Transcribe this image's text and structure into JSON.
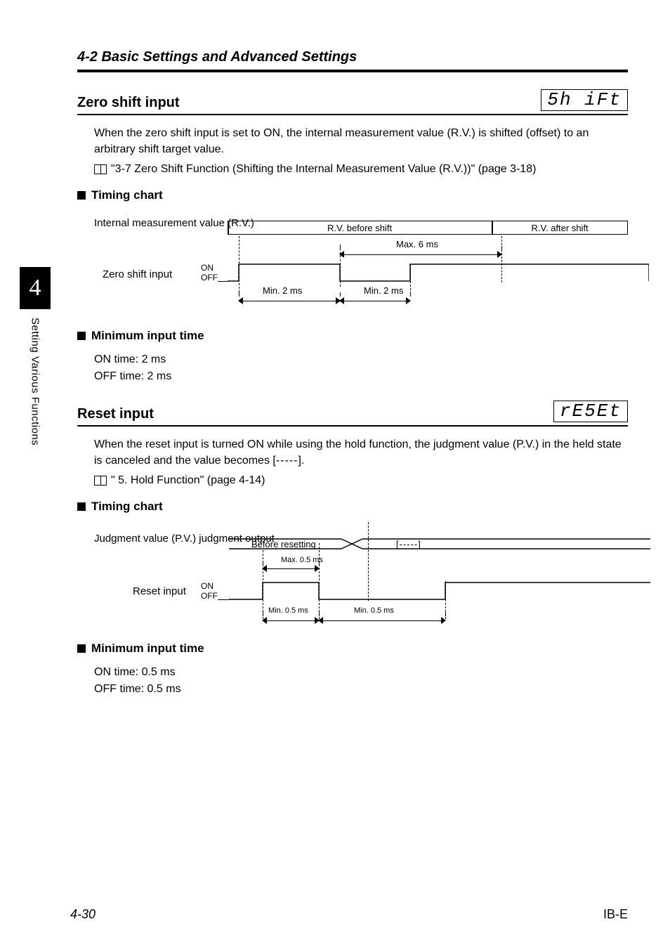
{
  "header": {
    "section": "4-2  Basic Settings and Advanced Settings"
  },
  "side": {
    "chapter_num": "4",
    "chapter_title": "Setting Various Functions"
  },
  "zero_shift": {
    "title": "Zero shift input",
    "seg": "5h iFt",
    "intro": "When the zero shift input is set to ON, the internal measurement value (R.V.) is shifted (offset) to an arbitrary shift target value.",
    "ref": "\"3-7 Zero Shift Function (Shifting the Internal Measurement Value (R.V.))\" (page 3-18)",
    "timing_title": "Timing chart",
    "min_title": "Minimum input time",
    "on_time": "ON time: 2 ms",
    "off_time": "OFF time: 2 ms",
    "chart": {
      "row_label": "Internal measurement value (R.V.)",
      "sig_label": "Zero shift input",
      "on": "ON",
      "off": "OFF",
      "before": "R.V. before shift",
      "after": "R.V. after shift",
      "max": "Max. 6 ms",
      "min_on": "Min. 2 ms",
      "min_off": "Min. 2 ms"
    }
  },
  "reset": {
    "title": "Reset input",
    "seg": "rE5Et",
    "intro_a": "When the reset input is turned ON while using the hold function, the judgment value (P.V.) in the held state is canceled and the value becomes [",
    "intro_dash": "-----",
    "intro_b": "].",
    "ref": "\" 5. Hold Function\" (page 4-14)",
    "timing_title": "Timing chart",
    "min_title": "Minimum input time",
    "on_time": "ON time: 0.5 ms",
    "off_time": "OFF time: 0.5 ms",
    "chart": {
      "row_label": "Judgment value (P.V.) judgment output",
      "sig_label": "Reset input",
      "on": "ON",
      "off": "OFF",
      "before": "Before resetting",
      "dashes": "[-----]",
      "max": "Max. 0.5 ms",
      "min_on": "Min. 0.5 ms",
      "min_off": "Min. 0.5 ms"
    }
  },
  "footer": {
    "left": "4-30",
    "right": "IB-E"
  }
}
